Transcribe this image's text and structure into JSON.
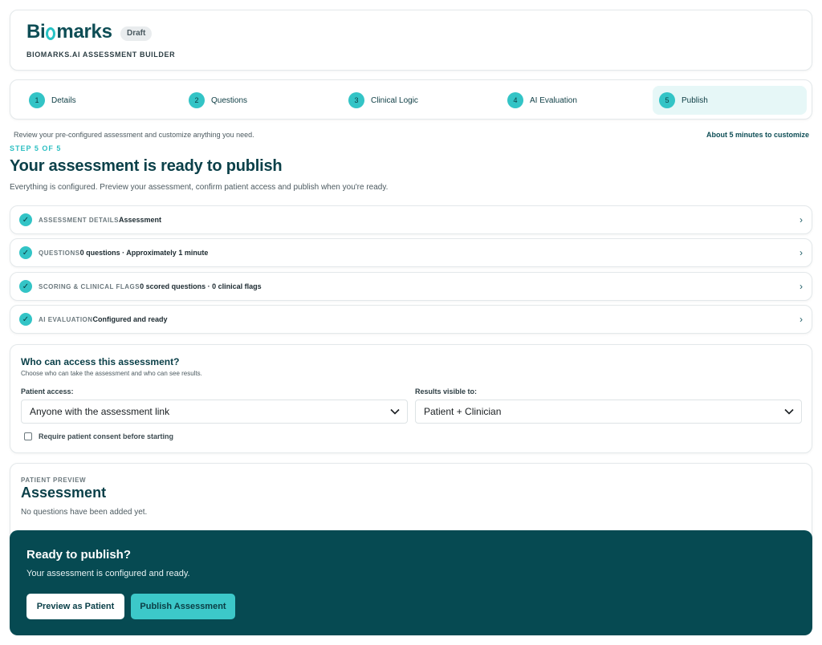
{
  "header": {
    "logo_pre": "Bi",
    "logo_post": "marks",
    "status_badge": "Draft",
    "subtitle": "BIOMARKS.AI ASSESSMENT BUILDER"
  },
  "stepper": {
    "steps": [
      {
        "num": "1",
        "label": "Details"
      },
      {
        "num": "2",
        "label": "Questions"
      },
      {
        "num": "3",
        "label": "Clinical Logic"
      },
      {
        "num": "4",
        "label": "AI Evaluation"
      },
      {
        "num": "5",
        "label": "Publish"
      }
    ],
    "active_step": "5"
  },
  "intro": {
    "text": "Review your pre-configured assessment and customize anything you need.",
    "estimate": "About 5 minutes to customize"
  },
  "page": {
    "step_label": "STEP 5 OF 5",
    "title": "Your assessment is ready to publish",
    "lead": "Everything is configured. Preview your assessment, confirm patient access and publish when you're ready."
  },
  "summary": [
    {
      "key": "ASSESSMENT DETAILS",
      "value": "Assessment"
    },
    {
      "key": "QUESTIONS",
      "value": "0 questions · Approximately 1 minute"
    },
    {
      "key": "SCORING & CLINICAL FLAGS",
      "value": "0 scored questions · 0 clinical flags"
    },
    {
      "key": "AI EVALUATION",
      "value": "Configured and ready"
    }
  ],
  "access": {
    "title": "Who can access this assessment?",
    "subtitle": "Choose who can take the assessment and who can see results.",
    "patient_access_label": "Patient access:",
    "patient_access_value": "Anyone with the assessment link",
    "results_label": "Results visible to:",
    "results_value": "Patient + Clinician",
    "consent_label": "Require patient consent before starting",
    "consent_checked": false
  },
  "preview": {
    "label": "PATIENT PREVIEW",
    "title": "Assessment",
    "empty": "No questions have been added yet."
  },
  "publish": {
    "title": "Ready to publish?",
    "subtitle": "Your assessment is configured and ready.",
    "preview_button": "Preview as Patient",
    "publish_button": "Publish Assessment"
  },
  "colors": {
    "brand_dark": "#064a52",
    "accent_teal": "#33c4c6",
    "active_step_bg": "#e6f7f7"
  },
  "icons": {
    "check": "check-icon",
    "chevron_right": "chevron-right-icon",
    "chevron_down": "chevron-down-icon"
  }
}
